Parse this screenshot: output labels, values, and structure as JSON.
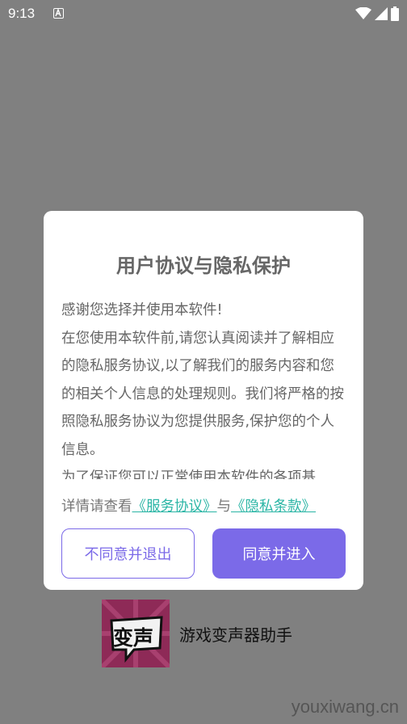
{
  "status_bar": {
    "time": "9:13",
    "icons": [
      "notification-a-icon",
      "wifi-icon",
      "signal-icon",
      "battery-icon"
    ]
  },
  "dialog": {
    "title": "用户协议与隐私保护",
    "body": [
      "感谢您选择并使用本软件!",
      "在您使用本软件前,请您认真阅读并了解相应的隐私服务协议,以了解我们的服务内容和您的相关个人信息的处理规则。我们将严格的按照隐私服务协议为您提供服务,保护您的个人信息。",
      "为了保证您可以正常使用本软件的各项基"
    ],
    "details_prefix": "详情请查看",
    "service_link": "《服务协议》",
    "and_text": "与",
    "privacy_link": "《隐私条款》",
    "decline_label": "不同意并退出",
    "agree_label": "同意并进入"
  },
  "app": {
    "logo_text": "变声",
    "name": "游戏变声器助手"
  },
  "watermark": "youxiwang.cn",
  "colors": {
    "accent": "#7b6ae8",
    "link": "#2ab5a5",
    "overlay": "#808080",
    "logo_bg": "#8e2a57"
  }
}
